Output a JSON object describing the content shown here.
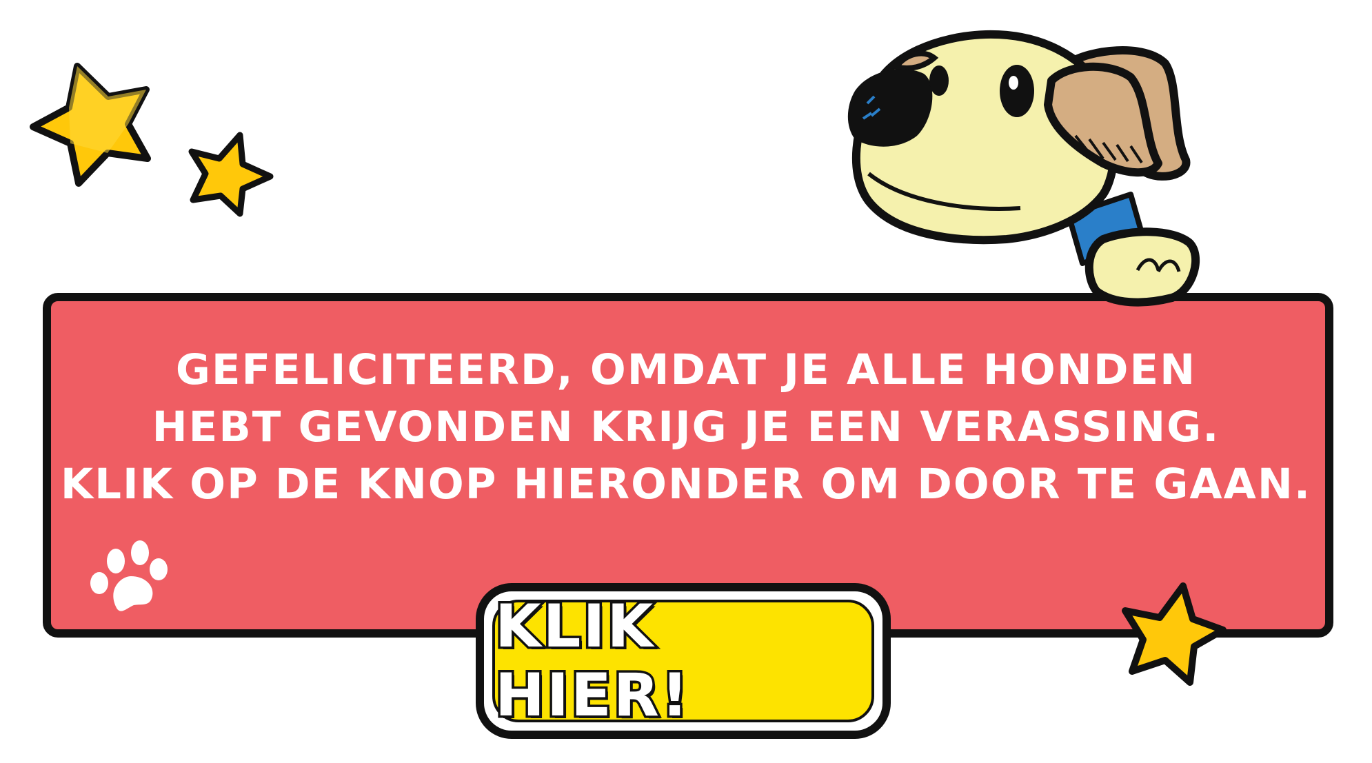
{
  "message": {
    "lines": [
      "GEFELICITEERD, OMDAT JE ALLE HONDEN",
      "HEBT GEVONDEN KRIJG JE EEN VERASSING.",
      "KLIK OP DE KNOP HIERONDER OM DOOR TE GAAN."
    ]
  },
  "cta": {
    "label": "KLIK HIER!"
  },
  "colors": {
    "panel": "#ef5d63",
    "button": "#fde300",
    "star": "#ffc80a",
    "dog_fur": "#f5f1ad",
    "dog_ear": "#d4ad82",
    "outline": "#111111"
  },
  "icons": [
    "star-icon",
    "paw-icon",
    "dog-illustration"
  ]
}
